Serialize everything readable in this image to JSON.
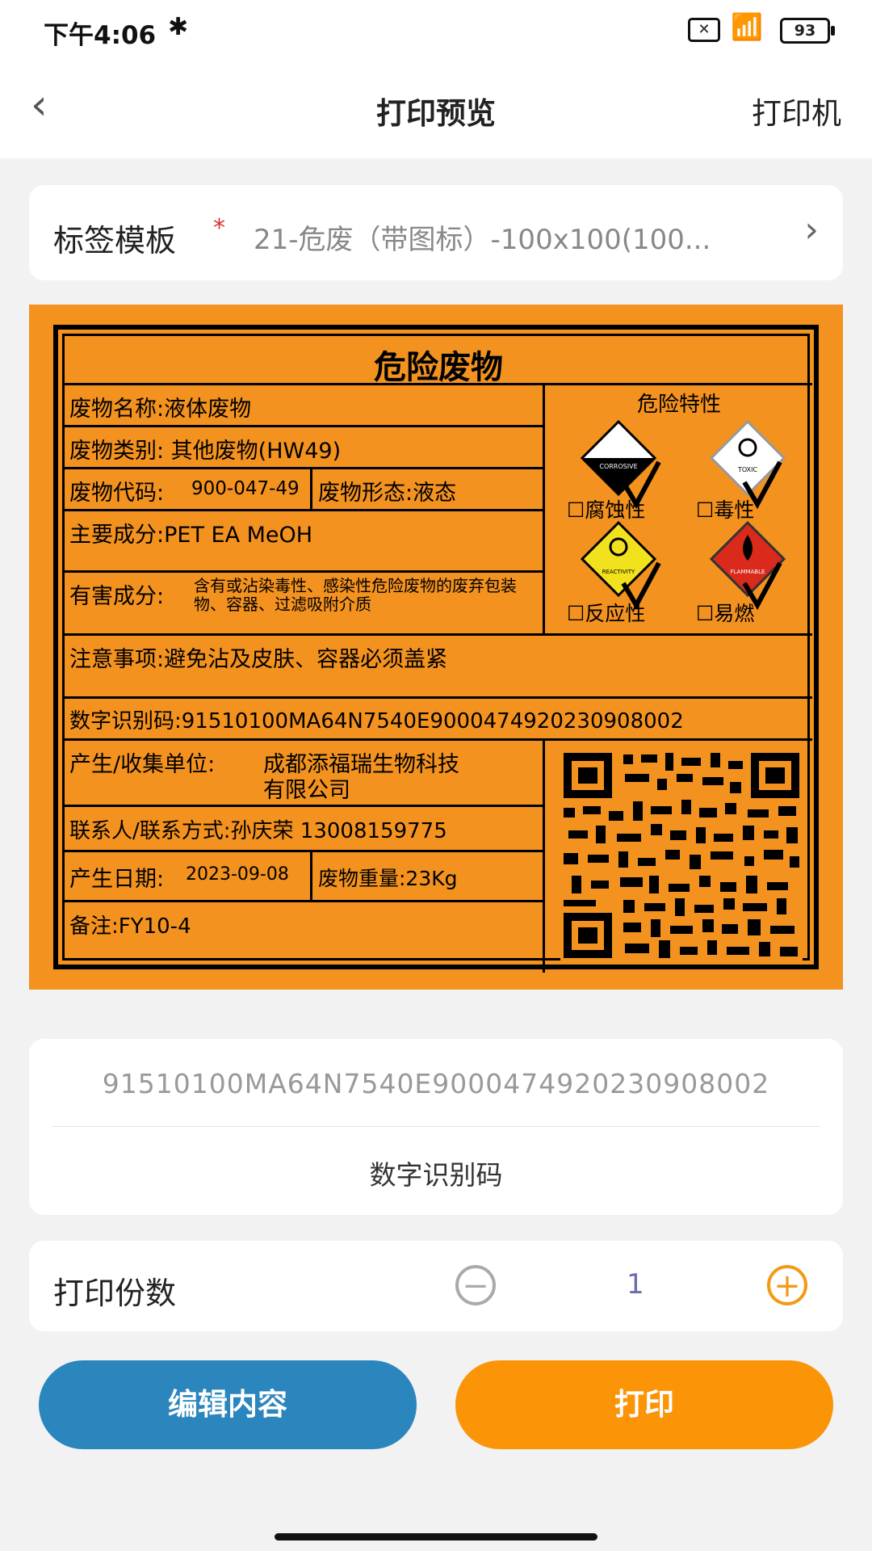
{
  "status": {
    "time": "下午4:06",
    "battery": "93"
  },
  "nav": {
    "title": "打印预览",
    "right": "打印机"
  },
  "template": {
    "label": "标签模板",
    "required": "*",
    "value": "21-危废（带图标）-100x100(100..."
  },
  "label": {
    "title": "危险废物",
    "waste_name": "废物名称:液体废物",
    "waste_category": "废物类别:  其他废物(HW49)",
    "waste_code_label": "废物代码:",
    "waste_code": "900-047-49",
    "waste_form": "废物形态:液态",
    "main_components": "主要成分:PET EA MeOH",
    "harmful_label": "有害成分:",
    "harmful_text": "含有或沾染毒性、感染性危险废物的废弃包装物、容器、过滤吸附介质",
    "notes_precaution": "注意事项:避免沾及皮肤、容器必须盖紧",
    "digital_id": "数字识别码:91510100MA64N7540E900047492023090800​2",
    "producer_label": "产生/收集单位:",
    "producer": "成都添福瑞生物科技有限公司",
    "producer_line1": "成都添福瑞生物科技",
    "producer_line2": "有限公司",
    "contact": "联系人/联系方式:孙庆荣  13008159775",
    "date_label": "产生日期:",
    "date": "2023-09-08",
    "weight": "废物重量:23Kg",
    "remark": "备注:FY10-4",
    "hazard_title": "危险特性",
    "hazards": [
      "腐蚀性",
      "毒性",
      "反应性",
      "易燃"
    ],
    "hazard_icon_text": [
      "CORROSIVE",
      "TOXIC",
      "REACTIVITY",
      "FLAMMABLE"
    ]
  },
  "digital_code": {
    "value": "91510100MA64N7540E900047492023090800​2",
    "caption": "数字识别码"
  },
  "copies": {
    "label": "打印份数",
    "value": "1"
  },
  "buttons": {
    "edit": "编辑内容",
    "print": "打印"
  },
  "colors": {
    "label_bg": "#f3921f",
    "edit_btn": "#2b86bd",
    "print_btn": "#fb9407"
  }
}
